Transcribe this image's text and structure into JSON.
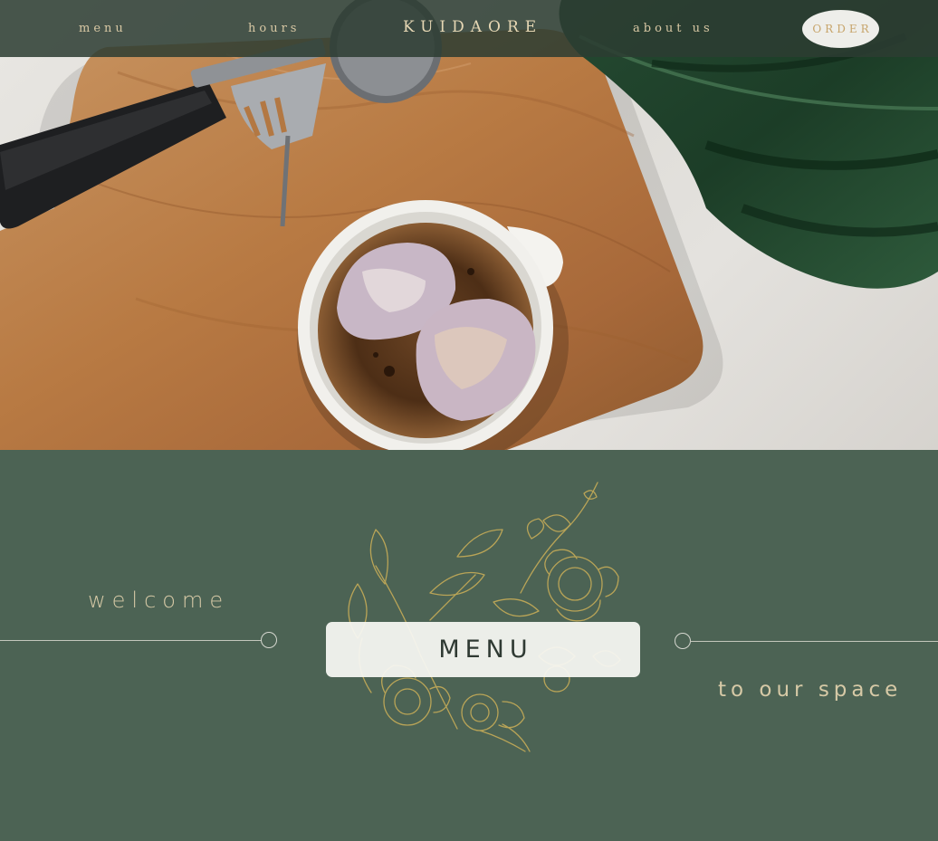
{
  "nav": {
    "links": {
      "menu": "menu",
      "hours": "hours",
      "about": "about us"
    },
    "brand": "KUIDAORE",
    "order_label": "ORDER"
  },
  "section": {
    "welcome": "welcome",
    "menu_button_label": "MENU",
    "tagline": "to our space"
  },
  "colors": {
    "nav_bg": "#2c3c32",
    "section_bg": "#4c6354",
    "gold_text": "#d6c9a6",
    "floral_gold": "#b9a457"
  }
}
